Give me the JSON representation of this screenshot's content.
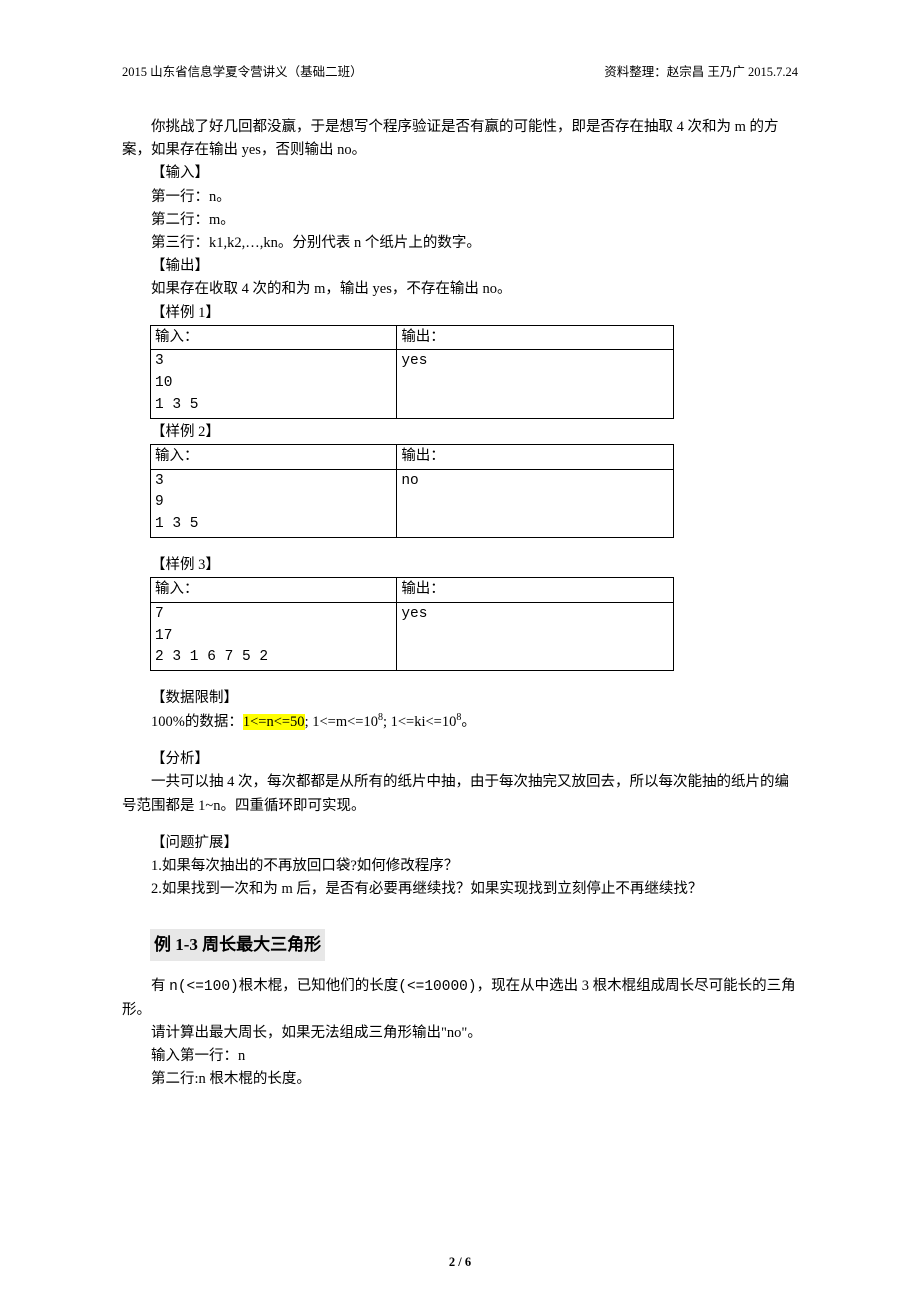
{
  "header": {
    "left": "2015 山东省信息学夏令营讲义（基础二班）",
    "right": "资料整理：赵宗昌  王乃广     2015.7.24"
  },
  "intro": {
    "p1": "你挑战了好几回都没赢，于是想写个程序验证是否有赢的可能性，即是否存在抽取 4 次和为 m 的方案，如果存在输出 yes，否则输出 no。",
    "input_label": "【输入】",
    "input_l1": "第一行：n。",
    "input_l2": "第二行：m。",
    "input_l3": "第三行：k1,k2,…,kn。分别代表 n 个纸片上的数字。",
    "output_label": "【输出】",
    "output_l1": "如果存在收取 4 次的和为 m，输出 yes，不存在输出 no。"
  },
  "sample_labels": {
    "s1": "【样例 1】",
    "s2": "【样例 2】",
    "s3": "【样例 3】",
    "th_in": "输入：",
    "th_out": "输出："
  },
  "samples": {
    "s1": {
      "in": "3\n10\n1 3 5",
      "out": "yes"
    },
    "s2": {
      "in": "3\n9\n1 3 5",
      "out": "no"
    },
    "s3": {
      "in": "7\n17\n2 3 1 6 7 5 2",
      "out": "yes"
    }
  },
  "limits": {
    "label": "【数据限制】",
    "prefix": "100%的数据：",
    "hl": "1<=n<=50",
    "rest_1": ";    1<=m<=10",
    "rest_2": ";    1<=ki<=10",
    "exp": "8",
    "tail": "。"
  },
  "analysis": {
    "label": "【分析】",
    "text": "一共可以抽 4 次，每次都都是从所有的纸片中抽，由于每次抽完又放回去，所以每次能抽的纸片的编号范围都是 1~n。四重循环即可实现。"
  },
  "extend": {
    "label": "【问题扩展】",
    "q1": "1.如果每次抽出的不再放回口袋?如何修改程序？",
    "q2": "2.如果找到一次和为 m 后，是否有必要再继续找？如果实现找到立刻停止不再继续找？"
  },
  "ex13": {
    "title": "例 1-3  周长最大三角形",
    "p1_a": "有 ",
    "p1_b": "n(<=100)",
    "p1_c": "根木棍，已知他们的长度",
    "p1_d": "(<=10000)",
    "p1_e": "，现在从中选出 3 根木棍组成周长尽可能长的三角形。",
    "p2": "请计算出最大周长，如果无法组成三角形输出\"no\"。",
    "p3": "输入第一行：n",
    "p4": "第二行:n 根木棍的长度。"
  },
  "footer": "2 / 6"
}
